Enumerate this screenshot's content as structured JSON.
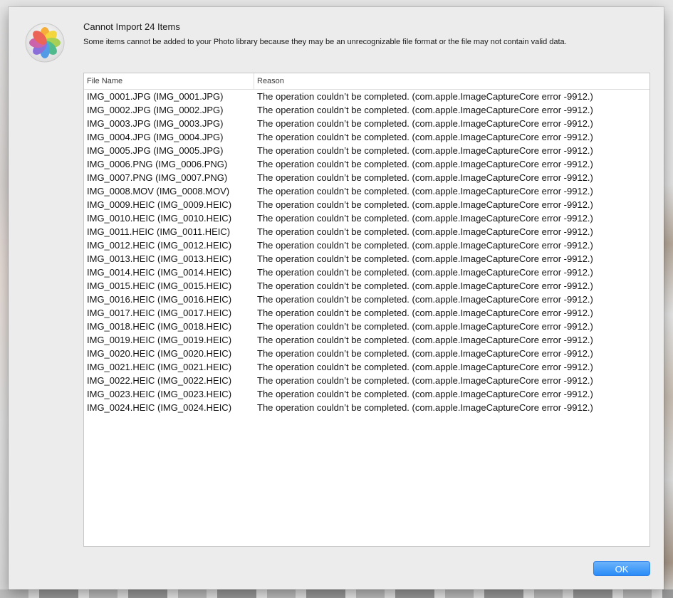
{
  "dialog": {
    "title": "Cannot Import 24 Items",
    "message": "Some items cannot be added to your Photo library because they may be an unrecognizable file format or the file may not contain valid data.",
    "ok_label": "OK",
    "icon": "photos-app-icon",
    "accent_color": "#2a8cf7"
  },
  "table": {
    "columns": [
      "File Name",
      "Reason"
    ],
    "rows": [
      {
        "file": "IMG_0001.JPG (IMG_0001.JPG)",
        "reason": "The operation couldn’t be completed. (com.apple.ImageCaptureCore error -9912.)"
      },
      {
        "file": "IMG_0002.JPG (IMG_0002.JPG)",
        "reason": "The operation couldn’t be completed. (com.apple.ImageCaptureCore error -9912.)"
      },
      {
        "file": "IMG_0003.JPG (IMG_0003.JPG)",
        "reason": "The operation couldn’t be completed. (com.apple.ImageCaptureCore error -9912.)"
      },
      {
        "file": "IMG_0004.JPG (IMG_0004.JPG)",
        "reason": "The operation couldn’t be completed. (com.apple.ImageCaptureCore error -9912.)"
      },
      {
        "file": "IMG_0005.JPG (IMG_0005.JPG)",
        "reason": "The operation couldn’t be completed. (com.apple.ImageCaptureCore error -9912.)"
      },
      {
        "file": "IMG_0006.PNG (IMG_0006.PNG)",
        "reason": "The operation couldn’t be completed. (com.apple.ImageCaptureCore error -9912.)"
      },
      {
        "file": "IMG_0007.PNG (IMG_0007.PNG)",
        "reason": "The operation couldn’t be completed. (com.apple.ImageCaptureCore error -9912.)"
      },
      {
        "file": "IMG_0008.MOV (IMG_0008.MOV)",
        "reason": "The operation couldn’t be completed. (com.apple.ImageCaptureCore error -9912.)"
      },
      {
        "file": "IMG_0009.HEIC (IMG_0009.HEIC)",
        "reason": "The operation couldn’t be completed. (com.apple.ImageCaptureCore error -9912.)"
      },
      {
        "file": "IMG_0010.HEIC (IMG_0010.HEIC)",
        "reason": "The operation couldn’t be completed. (com.apple.ImageCaptureCore error -9912.)"
      },
      {
        "file": "IMG_0011.HEIC (IMG_0011.HEIC)",
        "reason": "The operation couldn’t be completed. (com.apple.ImageCaptureCore error -9912.)"
      },
      {
        "file": "IMG_0012.HEIC (IMG_0012.HEIC)",
        "reason": "The operation couldn’t be completed. (com.apple.ImageCaptureCore error -9912.)"
      },
      {
        "file": "IMG_0013.HEIC (IMG_0013.HEIC)",
        "reason": "The operation couldn’t be completed. (com.apple.ImageCaptureCore error -9912.)"
      },
      {
        "file": "IMG_0014.HEIC (IMG_0014.HEIC)",
        "reason": "The operation couldn’t be completed. (com.apple.ImageCaptureCore error -9912.)"
      },
      {
        "file": "IMG_0015.HEIC (IMG_0015.HEIC)",
        "reason": "The operation couldn’t be completed. (com.apple.ImageCaptureCore error -9912.)"
      },
      {
        "file": "IMG_0016.HEIC (IMG_0016.HEIC)",
        "reason": "The operation couldn’t be completed. (com.apple.ImageCaptureCore error -9912.)"
      },
      {
        "file": "IMG_0017.HEIC (IMG_0017.HEIC)",
        "reason": "The operation couldn’t be completed. (com.apple.ImageCaptureCore error -9912.)"
      },
      {
        "file": "IMG_0018.HEIC (IMG_0018.HEIC)",
        "reason": "The operation couldn’t be completed. (com.apple.ImageCaptureCore error -9912.)"
      },
      {
        "file": "IMG_0019.HEIC (IMG_0019.HEIC)",
        "reason": "The operation couldn’t be completed. (com.apple.ImageCaptureCore error -9912.)"
      },
      {
        "file": "IMG_0020.HEIC (IMG_0020.HEIC)",
        "reason": "The operation couldn’t be completed. (com.apple.ImageCaptureCore error -9912.)"
      },
      {
        "file": "IMG_0021.HEIC (IMG_0021.HEIC)",
        "reason": "The operation couldn’t be completed. (com.apple.ImageCaptureCore error -9912.)"
      },
      {
        "file": "IMG_0022.HEIC (IMG_0022.HEIC)",
        "reason": "The operation couldn’t be completed. (com.apple.ImageCaptureCore error -9912.)"
      },
      {
        "file": "IMG_0023.HEIC (IMG_0023.HEIC)",
        "reason": "The operation couldn’t be completed. (com.apple.ImageCaptureCore error -9912.)"
      },
      {
        "file": "IMG_0024.HEIC (IMG_0024.HEIC)",
        "reason": "The operation couldn’t be completed. (com.apple.ImageCaptureCore error -9912.)"
      }
    ]
  }
}
